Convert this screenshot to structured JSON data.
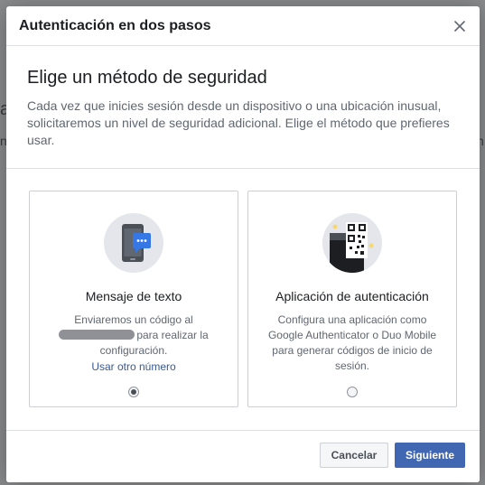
{
  "dialog": {
    "title": "Autenticación en dos pasos",
    "close_icon": "close-icon"
  },
  "intro": {
    "heading": "Elige un método de seguridad",
    "description": "Cada vez que inicies sesión desde un dispositivo o una ubicación inusual, solicitaremos un nivel de seguridad adicional. Elige el método que prefieres usar."
  },
  "options": [
    {
      "icon": "phone-message-icon",
      "title": "Mensaje de texto",
      "desc_before": "Enviaremos un código al",
      "desc_after": "para realizar la configuración.",
      "link": "Usar otro número",
      "selected": true
    },
    {
      "icon": "authenticator-qr-icon",
      "title": "Aplicación de autenticación",
      "description": "Configura una aplicación como Google Authenticator o Duo Mobile para generar códigos de inicio de sesión.",
      "selected": false
    }
  ],
  "footer": {
    "cancel_label": "Cancelar",
    "next_label": "Siguiente"
  },
  "colors": {
    "primary": "#4267b2",
    "link": "#385898",
    "message_bubble": "#3578e5"
  }
}
